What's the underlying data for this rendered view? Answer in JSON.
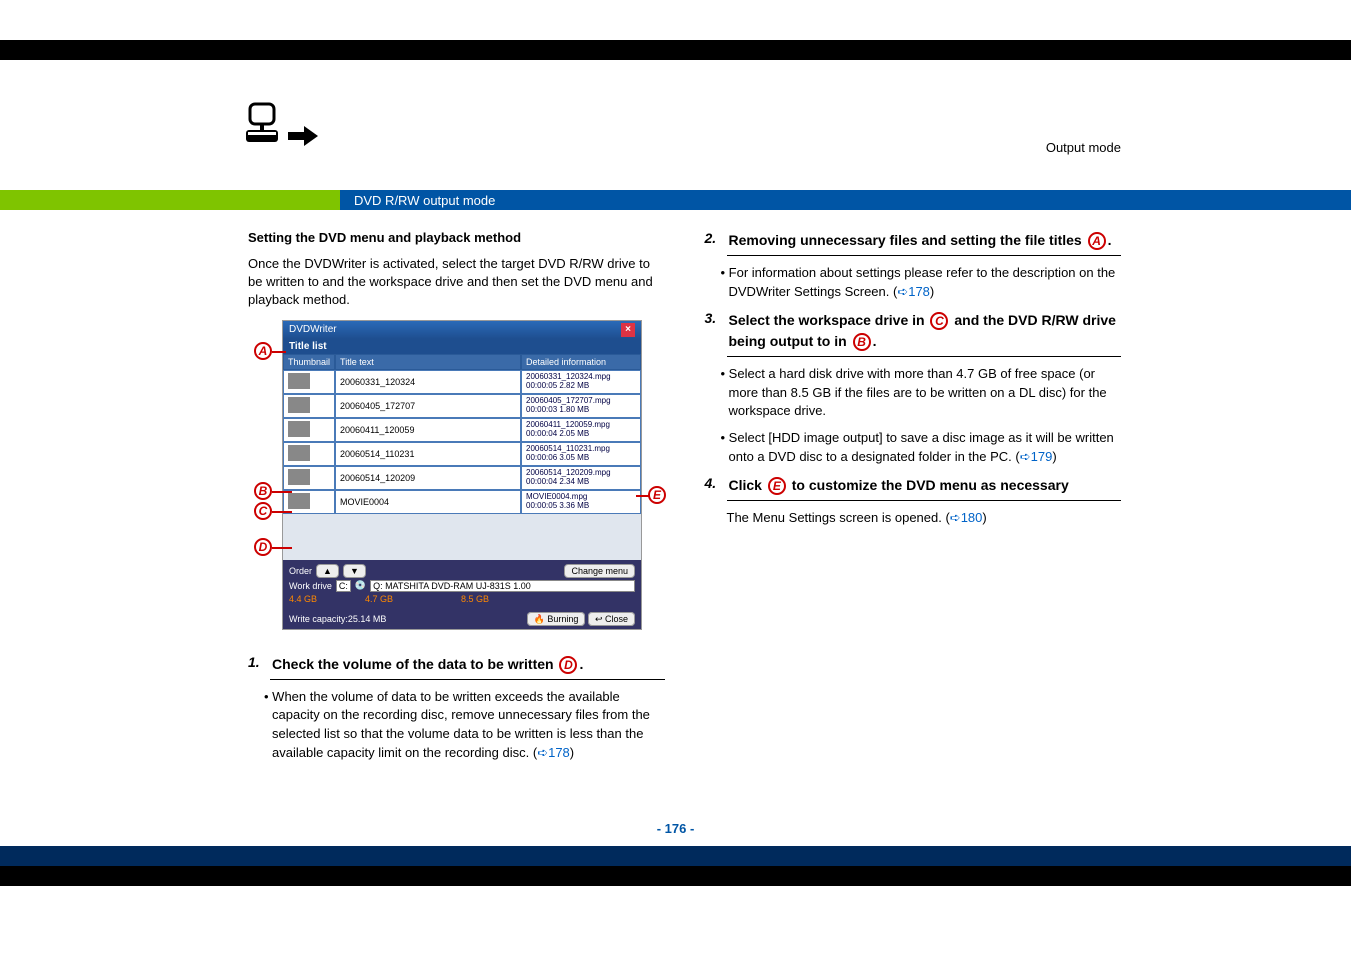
{
  "header": {
    "mode_label": "Output mode",
    "section_title": "DVD R/RW output mode"
  },
  "left": {
    "heading": "Setting the DVD menu and playback method",
    "intro": "Once the DVDWriter is activated, select the target DVD R/RW drive to be written to and the workspace drive and then set the DVD menu and playback method.",
    "screenshot": {
      "titlebar": "DVDWriter",
      "titlelist": "Title list",
      "hdr_thumb": "Thumbnail",
      "hdr_text": "Title text",
      "hdr_detail": "Detailed information",
      "rows": [
        {
          "text": "20060331_120324",
          "d1": "20060331_120324.mpg",
          "d2": "00:00:05 2.82 MB"
        },
        {
          "text": "20060405_172707",
          "d1": "20060405_172707.mpg",
          "d2": "00:00:03 1.80 MB"
        },
        {
          "text": "20060411_120059",
          "d1": "20060411_120059.mpg",
          "d2": "00:00:04 2.05 MB"
        },
        {
          "text": "20060514_110231",
          "d1": "20060514_110231.mpg",
          "d2": "00:00:06 3.05 MB"
        },
        {
          "text": "20060514_120209",
          "d1": "20060514_120209.mpg",
          "d2": "00:00:04 2.34 MB"
        },
        {
          "text": "MOVIE0004",
          "d1": "MOVIE0004.mpg",
          "d2": "00:00:05 3.36 MB"
        }
      ],
      "order": "Order",
      "change_menu": "Change menu",
      "work_drive": "Work drive",
      "work_drive_val": "C:",
      "output_drive": "Q: MATSHITA DVD-RAM UJ-831S 1.00",
      "markers": {
        "left": "4.4 GB",
        "mid": "4.7 GB",
        "right": "8.5 GB"
      },
      "write_cap": "Write capacity:25.14 MB",
      "burning": "Burning",
      "close": "Close"
    },
    "callouts": {
      "A": "A",
      "B": "B",
      "C": "C",
      "D": "D",
      "E": "E"
    },
    "step1_num": "1.",
    "step1_text": "Check the volume of the data to be written ",
    "step1_callout": "D",
    "step1_sub": "When the volume of data to be written exceeds the available capacity on the recording disc, remove unnecessary files from the selected list so that the volume data to be written is less than the available capacity limit on the recording disc. (",
    "step1_link": "178"
  },
  "right": {
    "step2_num": "2.",
    "step2_text": "Removing unnecessary files and setting the file titles ",
    "step2_callout": "A",
    "step2_sub": "For information about settings please refer to the description on the DVDWriter Settings Screen. (",
    "step2_link": "178",
    "step3_num": "3.",
    "step3_text_a": "Select the workspace drive in ",
    "step3_callout_a": "C",
    "step3_text_b": " and the DVD R/RW drive being output to in ",
    "step3_callout_b": "B",
    "step3_sub1": "Select a hard disk drive with more than 4.7 GB of free space (or more than 8.5 GB if the files are to be written on a DL disc) for the workspace drive.",
    "step3_sub2": "Select [HDD image output] to save a disc image as it will be written onto a DVD disc to a designated folder in the PC. (",
    "step3_link": "179",
    "step4_num": "4.",
    "step4_text_a": "Click ",
    "step4_callout": "E",
    "step4_text_b": " to customize the DVD menu as necessary",
    "step4_sub": "The Menu Settings screen is opened. (",
    "step4_link": "180"
  },
  "page_num": "- 176 -"
}
